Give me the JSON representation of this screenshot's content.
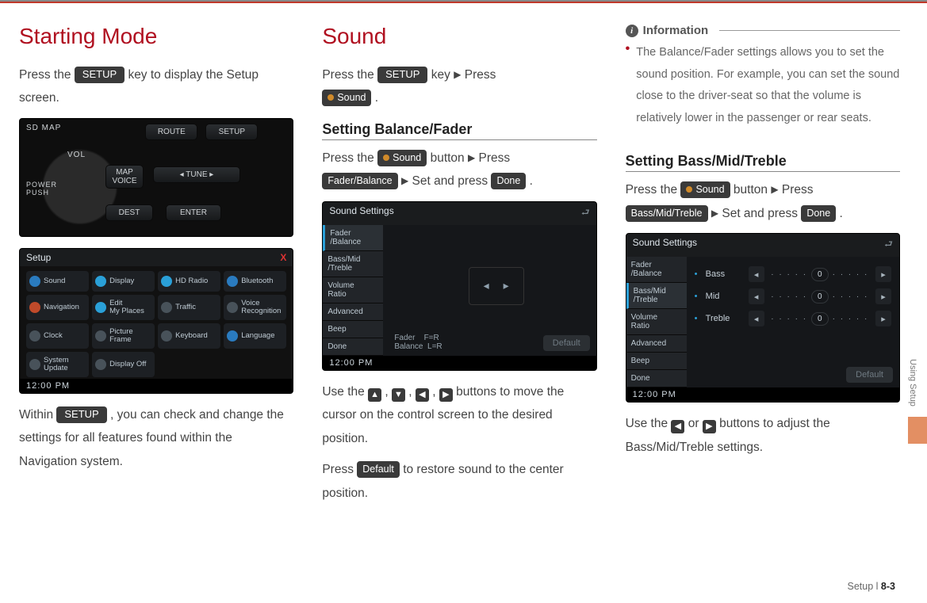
{
  "col1": {
    "title": "Starting Mode",
    "p1a": "Press the ",
    "setup_key": "SETUP",
    "p1b": " key  to display the Setup screen.",
    "hardware": {
      "sd": "SD MAP",
      "route": "ROUTE",
      "setup": "SETUP",
      "vol": "VOL",
      "power": "POWER\nPUSH",
      "mapvoice": "MAP\nVOICE",
      "tune": "◂  TUNE  ▸",
      "dest": "DEST",
      "enter": "ENTER"
    },
    "setup_shot": {
      "title": "Setup",
      "close": "X",
      "cells": [
        {
          "label": "Sound",
          "color": "#2a7bbf"
        },
        {
          "label": "Display",
          "color": "#2aa0d8"
        },
        {
          "label": "HD Radio",
          "color": "#2aa0d8"
        },
        {
          "label": "Bluetooth",
          "color": "#2a7bbf"
        },
        {
          "label": "Navigation",
          "color": "#c04a2a"
        },
        {
          "label": "Edit\nMy Places",
          "color": "#2aa0d8"
        },
        {
          "label": "Traffic",
          "color": "#48525a"
        },
        {
          "label": "Voice\nRecognition",
          "color": "#48525a"
        },
        {
          "label": "Clock",
          "color": "#48525a"
        },
        {
          "label": "Picture\nFrame",
          "color": "#48525a"
        },
        {
          "label": "Keyboard",
          "color": "#48525a"
        },
        {
          "label": "Language",
          "color": "#2a7bbf"
        },
        {
          "label": "System\nUpdate",
          "color": "#48525a"
        },
        {
          "label": "Display Off",
          "color": "#48525a"
        }
      ],
      "clock": "12:00 PM"
    },
    "p2a": "Within ",
    "p2b": " , you can check and change the settings for all features found within the Navigation system."
  },
  "col2": {
    "title": "Sound",
    "p1a": "Press the ",
    "setup_key": "SETUP",
    "p1b": " key ",
    "p1c": " Press",
    "sound_key": "Sound",
    "sub1": "Setting Balance/Fader",
    "s1a": "Press the ",
    "s1b": " button ",
    "s1c": " Press",
    "fb_key": "Fader/Balance",
    "s1d": " Set and press ",
    "done_key": "Done",
    "ss_shot": {
      "title": "Sound Settings",
      "tabs": [
        "Fader\n/Balance",
        "Bass/Mid\n/Treble",
        "Volume\nRatio",
        "Advanced",
        "Beep",
        "Done"
      ],
      "lbls": "Fader    F=R\nBalance  L=R",
      "default": "Default",
      "clock": "12:00 PM"
    },
    "p2a": "Use the ",
    "p2b": " buttons to move the cursor on the control screen to the desired position.",
    "p3a": "Press ",
    "default_key": "Default",
    "p3b": " to restore sound to the cen­ter position."
  },
  "col3": {
    "info_label": "Information",
    "info_text": "The Balance/Fader settings allows you to set the sound position. For example, you can set the sound close to the driver-seat so that the volume is relatively lower in the passenger or rear seats.",
    "sub2": "Setting Bass/Mid/Treble",
    "s2a": "Press the ",
    "sound_key": "Sound",
    "s2b": " button ",
    "s2c": " Press",
    "bmt_key": "Bass/Mid/Treble",
    "s2d": " Set and press ",
    "done_key": "Done",
    "bmt_shot": {
      "title": "Sound Settings",
      "tabs": [
        "Fader\n/Balance",
        "Bass/Mid\n/Treble",
        "Volume\nRatio",
        "Advanced",
        "Beep",
        "Done"
      ],
      "rows": [
        {
          "name": "Bass",
          "val": "0"
        },
        {
          "name": "Mid",
          "val": "0"
        },
        {
          "name": "Treble",
          "val": "0"
        }
      ],
      "default": "Default",
      "clock": "12:00 PM"
    },
    "p4a": "Use the ",
    "p4b": " or ",
    "p4c": " buttons to adjust the Bass/Mid/Treble settings."
  },
  "side_label": "Using Setup",
  "footer": {
    "section": "Setup",
    "sep": "  l  ",
    "page": "8-3"
  }
}
